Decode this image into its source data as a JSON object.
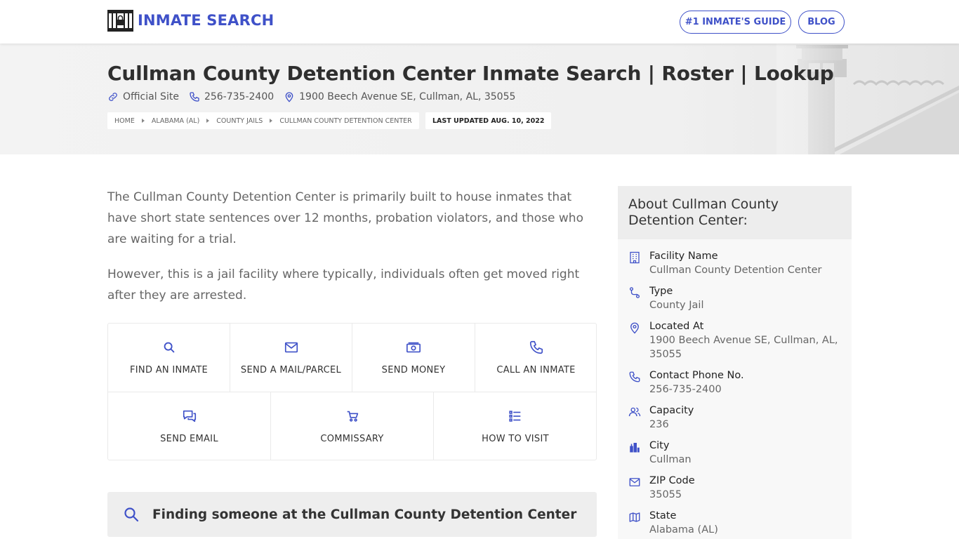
{
  "nav": {
    "brand": "INMATE SEARCH",
    "guide_button": "#1 INMATE'S GUIDE",
    "blog_button": "BLOG"
  },
  "hero": {
    "title": "Cullman County Detention Center Inmate Search | Roster | Lookup",
    "official_site": "Official Site",
    "phone": "256-735-2400",
    "address": "1900 Beech Avenue SE, Cullman, AL, 35055",
    "breadcrumb": [
      "HOME",
      "ALABAMA (AL)",
      "COUNTY JAILS",
      "CULLMAN COUNTY DETENTION CENTER"
    ],
    "last_updated": "LAST UPDATED AUG. 10, 2022"
  },
  "intro": {
    "p1": "The Cullman County Detention Center is primarily built to house inmates that have short state sentences over 12 months, probation violators, and those who are waiting for a trial.",
    "p2": "However, this is a jail facility where typically, individuals often get moved right after they are arrested."
  },
  "actions": {
    "find_inmate": "FIND AN INMATE",
    "send_mail": "SEND A MAIL/PARCEL",
    "send_money": "SEND MONEY",
    "call_inmate": "CALL AN INMATE",
    "send_email": "SEND EMAIL",
    "commissary": "COMMISSARY",
    "how_to_visit": "HOW TO VISIT"
  },
  "find_section": {
    "heading": "Finding someone at the Cullman County Detention Center"
  },
  "sidebar": {
    "title": "About Cullman County Detention Center:",
    "items": [
      {
        "label": "Facility Name",
        "value": "Cullman County Detention Center",
        "icon": "building-icon"
      },
      {
        "label": "Type",
        "value": "County Jail",
        "icon": "route-icon"
      },
      {
        "label": "Located At",
        "value": "1900 Beech Avenue SE, Cullman, AL, 35055",
        "icon": "map-pin-icon"
      },
      {
        "label": "Contact Phone No.",
        "value": "256-735-2400",
        "icon": "phone-icon"
      },
      {
        "label": "Capacity",
        "value": "236",
        "icon": "users-icon"
      },
      {
        "label": "City",
        "value": "Cullman",
        "icon": "city-icon"
      },
      {
        "label": "ZIP Code",
        "value": "35055",
        "icon": "mail-icon"
      },
      {
        "label": "State",
        "value": "Alabama (AL)",
        "icon": "map-icon"
      }
    ]
  },
  "colors": {
    "accent": "#3f51c8",
    "hero_bg": "#f0f0f0",
    "sidebar_bg": "#f8f8f8",
    "sidebar_head_bg": "#ededed"
  }
}
